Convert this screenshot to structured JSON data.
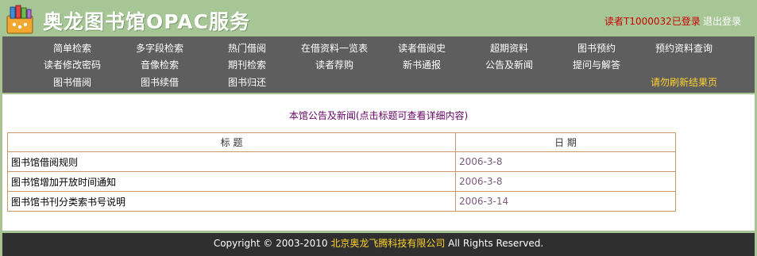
{
  "header": {
    "site_title": "奥龙图书馆OPAC服务",
    "user_status": "读者T1000032已登录",
    "logout": "退出登录"
  },
  "nav": {
    "row1": [
      "简单检索",
      "多字段检索",
      "热门借阅",
      "在借资料一览表",
      "读者借阅史",
      "超期资料",
      "图书预约",
      "预约资料查询"
    ],
    "row2": [
      "读者修改密码",
      "音像检索",
      "期刊检索",
      "读者荐购",
      "新书通报",
      "公告及新闻",
      "提问与解答"
    ],
    "row3": [
      "图书借阅",
      "图书续借",
      "图书归还"
    ],
    "notice": "请勿刷新结果页"
  },
  "main": {
    "title": "本馆公告及新闻(点击标题可查看详细内容)",
    "columns": [
      "标 题",
      "日 期"
    ],
    "rows": [
      {
        "title": "图书馆借阅规则",
        "date": "2006-3-8"
      },
      {
        "title": "图书馆增加开放时间通知",
        "date": "2006-3-8"
      },
      {
        "title": "图书馆书刊分类索书号说明",
        "date": "2006-3-14"
      }
    ]
  },
  "footer": {
    "prefix": "Copyright © 2003-2010 ",
    "company": "北京奥龙飞腾科技有限公司",
    "suffix": "  All Rights Reserved."
  },
  "colors": {
    "header_bg": "#a6c695",
    "nav_bg": "#5e5e5e",
    "status_red": "#cc0000",
    "notice_yellow": "#ffd22e",
    "footer_bg": "#2f2f2f"
  },
  "icons": {
    "logo": "books-stack-icon"
  }
}
